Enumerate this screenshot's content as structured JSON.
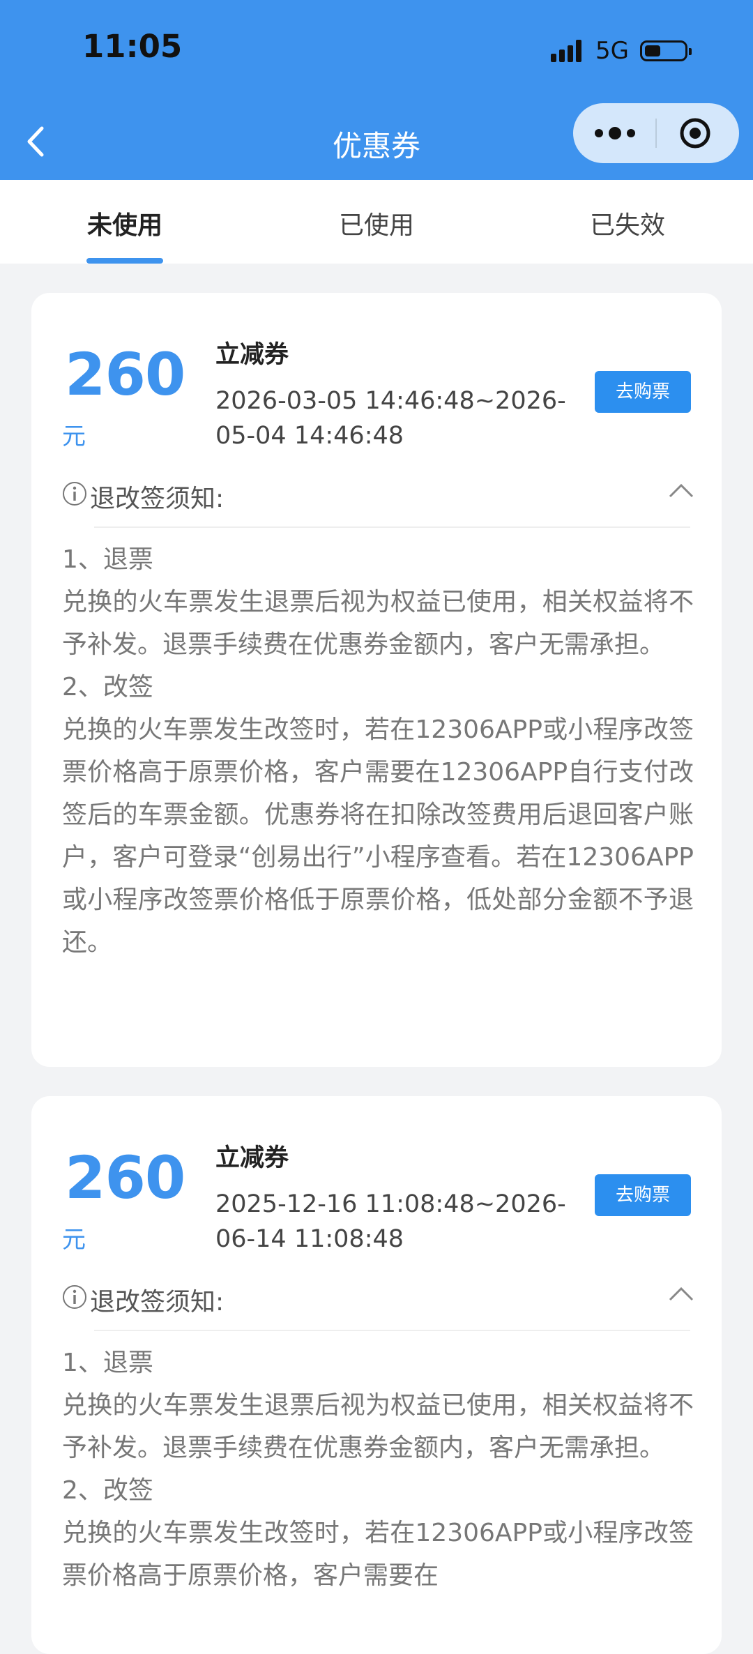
{
  "status_bar": {
    "time": "11:05",
    "network": "5G"
  },
  "nav": {
    "title": "优惠券"
  },
  "tabs": [
    {
      "label": "未使用"
    },
    {
      "label": "已使用"
    },
    {
      "label": "已失效"
    }
  ],
  "coupons": [
    {
      "amount": "260",
      "unit": "元",
      "type": "立减券",
      "validity": "2026-03-05 14:46:48~2026-05-04 14:46:48",
      "button": "去购票",
      "notice_label": "退改签须知:",
      "notice": [
        "1、退票",
        "兑换的火车票发生退票后视为权益已使用，相关权益将不予补发。退票手续费在优惠券金额内，客户无需承担。",
        "2、改签",
        "兑换的火车票发生改签时，若在12306APP或小程序改签票价格高于原票价格，客户需要在12306APP自行支付改签后的车票金额。优惠券将在扣除改签费用后退回客户账户，客户可登录“创易出行”小程序查看。若在12306APP或小程序改签票价格低于原票价格，低处部分金额不予退还。"
      ]
    },
    {
      "amount": "260",
      "unit": "元",
      "type": "立减券",
      "validity": "2025-12-16 11:08:48~2026-06-14 11:08:48",
      "button": "去购票",
      "notice_label": "退改签须知:",
      "notice": [
        "1、退票",
        "兑换的火车票发生退票后视为权益已使用，相关权益将不予补发。退票手续费在优惠券金额内，客户无需承担。",
        "2、改签",
        "兑换的火车票发生改签时，若在12306APP或小程序改签票价格高于原票价格，客户需要在"
      ]
    }
  ]
}
